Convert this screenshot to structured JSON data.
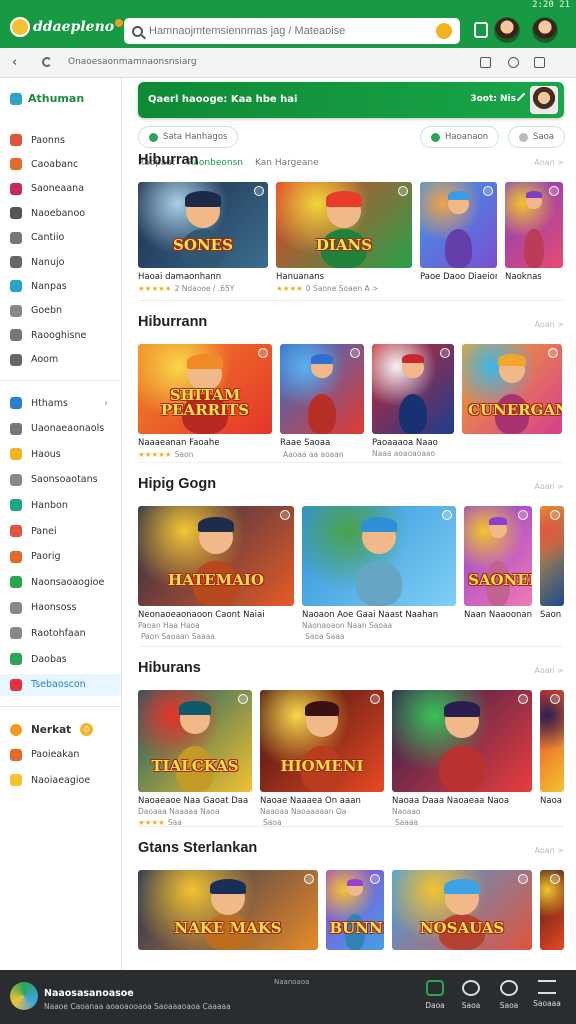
{
  "status": {
    "time": "2:20 21"
  },
  "app": {
    "logo_text": "ddaepleno",
    "search_placeholder": "Hamnaojmtemsiennmas jag / Mateaoise",
    "colors": {
      "brand": "#179a43",
      "accent": "#f2b320",
      "active": "#2a7fd4"
    }
  },
  "navbar": {
    "url": "Onaoesaonmamnaonsnsiarg",
    "back_icon": "arrow-left-icon",
    "reload_icon": "reload-icon"
  },
  "sidebar": {
    "header": "Athuman",
    "groups": [
      {
        "items": [
          {
            "label": "Paonns",
            "color": "#e2533d"
          },
          {
            "label": "Caoabanc",
            "color": "#e46b2b"
          },
          {
            "label": "Saoneaana",
            "color": "#c72a5a"
          },
          {
            "label": "Naoebanoo",
            "color": "#555555"
          },
          {
            "label": "Cantiio",
            "color": "#777777"
          },
          {
            "label": "Nanujo",
            "color": "#666666"
          },
          {
            "label": "Nanpas",
            "color": "#2ba4c8"
          },
          {
            "label": "Goebn",
            "color": "#888888"
          },
          {
            "label": "Raooghisne",
            "color": "#777777"
          },
          {
            "label": "Aoom",
            "color": "#666666"
          }
        ]
      },
      {
        "items": [
          {
            "label": "Hthams",
            "color": "#2a7fd4",
            "chevron": true
          },
          {
            "label": "Uaonaeaonaols",
            "color": "#777777"
          },
          {
            "label": "Haous",
            "color": "#f2b320"
          },
          {
            "label": "Saonsoaotans",
            "color": "#888888"
          },
          {
            "label": "Hanbon",
            "color": "#1aa688"
          },
          {
            "label": "Panei",
            "color": "#e2533d"
          },
          {
            "label": "Paorig",
            "color": "#e46b2b"
          },
          {
            "label": "Naonsaoaogioe",
            "color": "#2aa553"
          },
          {
            "label": "Haonsoss",
            "color": "#888888"
          },
          {
            "label": "Raotohfaan",
            "color": "#888888"
          },
          {
            "label": "Daobas",
            "color": "#2aa553"
          },
          {
            "label": "Tsebaoscon",
            "color": "#e2333d",
            "active": true
          }
        ]
      },
      {
        "items": [
          {
            "label": "Nerkat",
            "color": "#f39a1f",
            "badge": "0",
            "bold": true
          },
          {
            "label": "Paoieakan",
            "color": "#e46b2b"
          },
          {
            "label": "Naoiaeagioe",
            "color": "#f2c230"
          }
        ]
      }
    ]
  },
  "banner": {
    "text": "Qaerl haooge: Kaa hbe hai",
    "action": "3oot: Nis"
  },
  "chips": [
    {
      "label": "Sata   Hanhagos",
      "dot": "#2aa553"
    },
    {
      "label": "Haoanaon",
      "dot": "#2aa553"
    },
    {
      "label": "Saoa",
      "dot": "#bbbbbb"
    }
  ],
  "subtabs": [
    {
      "label": "Raopaat",
      "active": false
    },
    {
      "label": "Raonbeonsn",
      "active": true
    },
    {
      "label": "Kan  Hargeane",
      "active": false
    }
  ],
  "sections": [
    {
      "title": "Hiburran",
      "more": "Anan >",
      "items": [
        {
          "poster": "SONES",
          "title": "Haoai damaonhann",
          "sub": "",
          "stars": "★★★★★",
          "rating": "2 Ndaooe / .65Y",
          "palette": [
            "#1c2a4a",
            "#3b6e8f",
            "#a8d0e6"
          ]
        },
        {
          "poster": "DIANS",
          "title": "Hanuanans",
          "sub": "",
          "stars": "★★★★",
          "rating": "0  Saone Soaen  A  >",
          "palette": [
            "#e93c2b",
            "#25a24a",
            "#f4d43a"
          ]
        },
        {
          "poster": "",
          "title": "Paoe Daoo Diaeion",
          "sub": "",
          "stars": "",
          "rating": "",
          "palette": [
            "#3a9be6",
            "#7a4fd3",
            "#f1a24a"
          ]
        },
        {
          "poster": "",
          "title": "Naoknas",
          "sub": "",
          "stars": "",
          "rating": "",
          "palette": [
            "#7b3fc6",
            "#e94b6f",
            "#f4c330"
          ]
        }
      ]
    },
    {
      "title": "Hiburrann",
      "more": "Aoan >",
      "items": [
        {
          "poster": "SHITAM PEARRITS",
          "title": "Naaaeanan  Faoahe",
          "sub": "",
          "stars": "★★★★★",
          "rating": "Saon",
          "palette": [
            "#f08a26",
            "#e6332b",
            "#f9d84a"
          ]
        },
        {
          "poster": "",
          "title": "Raae Saoaa",
          "sub": "",
          "stars": "",
          "rating": "Aaoaa  aa  aoaan",
          "palette": [
            "#2e6fd1",
            "#e23b2f",
            "#5ab2f1"
          ]
        },
        {
          "poster": "",
          "title": "Paoaaaoa Naao",
          "sub": "Naaa aoaoaoaao",
          "stars": "",
          "rating": "",
          "palette": [
            "#c9262e",
            "#1e3d8f",
            "#f4f4f4"
          ]
        },
        {
          "poster": "CUNERGANS",
          "title": "",
          "sub": "",
          "stars": "",
          "rating": "",
          "palette": [
            "#f2a72c",
            "#d63f8c",
            "#3cb6e8"
          ]
        }
      ]
    },
    {
      "title": "Hipig Gogn",
      "more": "Aoan >",
      "items": [
        {
          "poster": "HATEMAIO",
          "title": "Neonaoeaonaoon Caont Naiai",
          "sub": "Paoan  Haa Haoa",
          "stars": "",
          "rating": "Paon Saoaan  Saaaa",
          "palette": [
            "#1f2b4a",
            "#e65b26",
            "#f3c636"
          ]
        },
        {
          "poster": "",
          "title": "Naoaon  Aoe  Gaai Naast Naahan",
          "sub": "Naonaoaon Naan Saoaa",
          "stars": "",
          "rating": "Saoa  Saaa",
          "palette": [
            "#2f8fd8",
            "#7fd0f5",
            "#4aa24a"
          ]
        },
        {
          "poster": "SAONEI",
          "title": "Naan Naaoonan",
          "sub": "",
          "stars": "",
          "rating": "",
          "palette": [
            "#8a3fd0",
            "#f27ab4",
            "#f4c330"
          ]
        },
        {
          "poster": "",
          "title": "Saon",
          "sub": "",
          "stars": "",
          "rating": "",
          "palette": [
            "#f4a42c",
            "#1c4a8a",
            "#e2533d"
          ]
        }
      ]
    },
    {
      "title": "Hiburans",
      "more": "Aoan >",
      "items": [
        {
          "poster": "TIALCKAS",
          "title": "Naoaeaoe  Naa  Gaoat  Daa",
          "sub": "Daoaaa   Naaaaa  Naoa",
          "stars": "★★★★",
          "rating": "Saa",
          "palette": [
            "#0e5a6a",
            "#f2c230",
            "#e6332b"
          ]
        },
        {
          "poster": "HIOMENI",
          "title": "Naoae Naaaea  On  aaan",
          "sub": "Naaoaa  Naoaaaaan Oa",
          "stars": "",
          "rating": "Saoa",
          "palette": [
            "#3a1010",
            "#e84a24",
            "#f9d84a"
          ]
        },
        {
          "poster": "",
          "title": "Naoaa Daaa Naoaeaa Naoa",
          "sub": "Naoaao",
          "stars": "",
          "rating": "Saaaa",
          "palette": [
            "#2a1e4f",
            "#e93d3d",
            "#38c25a"
          ]
        },
        {
          "poster": "",
          "title": "Naoa",
          "sub": "",
          "stars": "",
          "rating": "",
          "palette": [
            "#e8332b",
            "#f4c330",
            "#2a1e4f"
          ]
        }
      ]
    },
    {
      "title": "Gtans Sterlankan",
      "more": "Aoan >",
      "items": [
        {
          "poster": "NAKE MAKS",
          "title": "",
          "sub": "",
          "stars": "",
          "rating": "",
          "palette": [
            "#1a2e5a",
            "#e88a26",
            "#f4c330"
          ]
        },
        {
          "poster": "BUNNS",
          "title": "",
          "sub": "",
          "stars": "",
          "rating": "",
          "palette": [
            "#9b3fd0",
            "#3fa3e6",
            "#f4c330"
          ]
        },
        {
          "poster": "NOSAUAS",
          "title": "",
          "sub": "",
          "stars": "",
          "rating": "",
          "palette": [
            "#3ea3e6",
            "#e2533d",
            "#f4c330"
          ]
        },
        {
          "poster": "",
          "title": "",
          "sub": "",
          "stars": "",
          "rating": "",
          "palette": [
            "#3a1010",
            "#e84a24",
            "#f4c330"
          ]
        }
      ]
    }
  ],
  "bottombar": {
    "title": "Naaosasanoasoe",
    "subtitle": "Naaoe Caoanaa  aoaoaooaoa  Saoaaaoaoa  Caaaaa",
    "center": "Naanoaoa",
    "actions": [
      {
        "label": "Daoa",
        "icon": "store-icon"
      },
      {
        "label": "Saoa",
        "icon": "chat-icon"
      },
      {
        "label": "Saoa",
        "icon": "user-icon"
      },
      {
        "label": "Saoaaa",
        "icon": "menu-icon"
      }
    ]
  }
}
